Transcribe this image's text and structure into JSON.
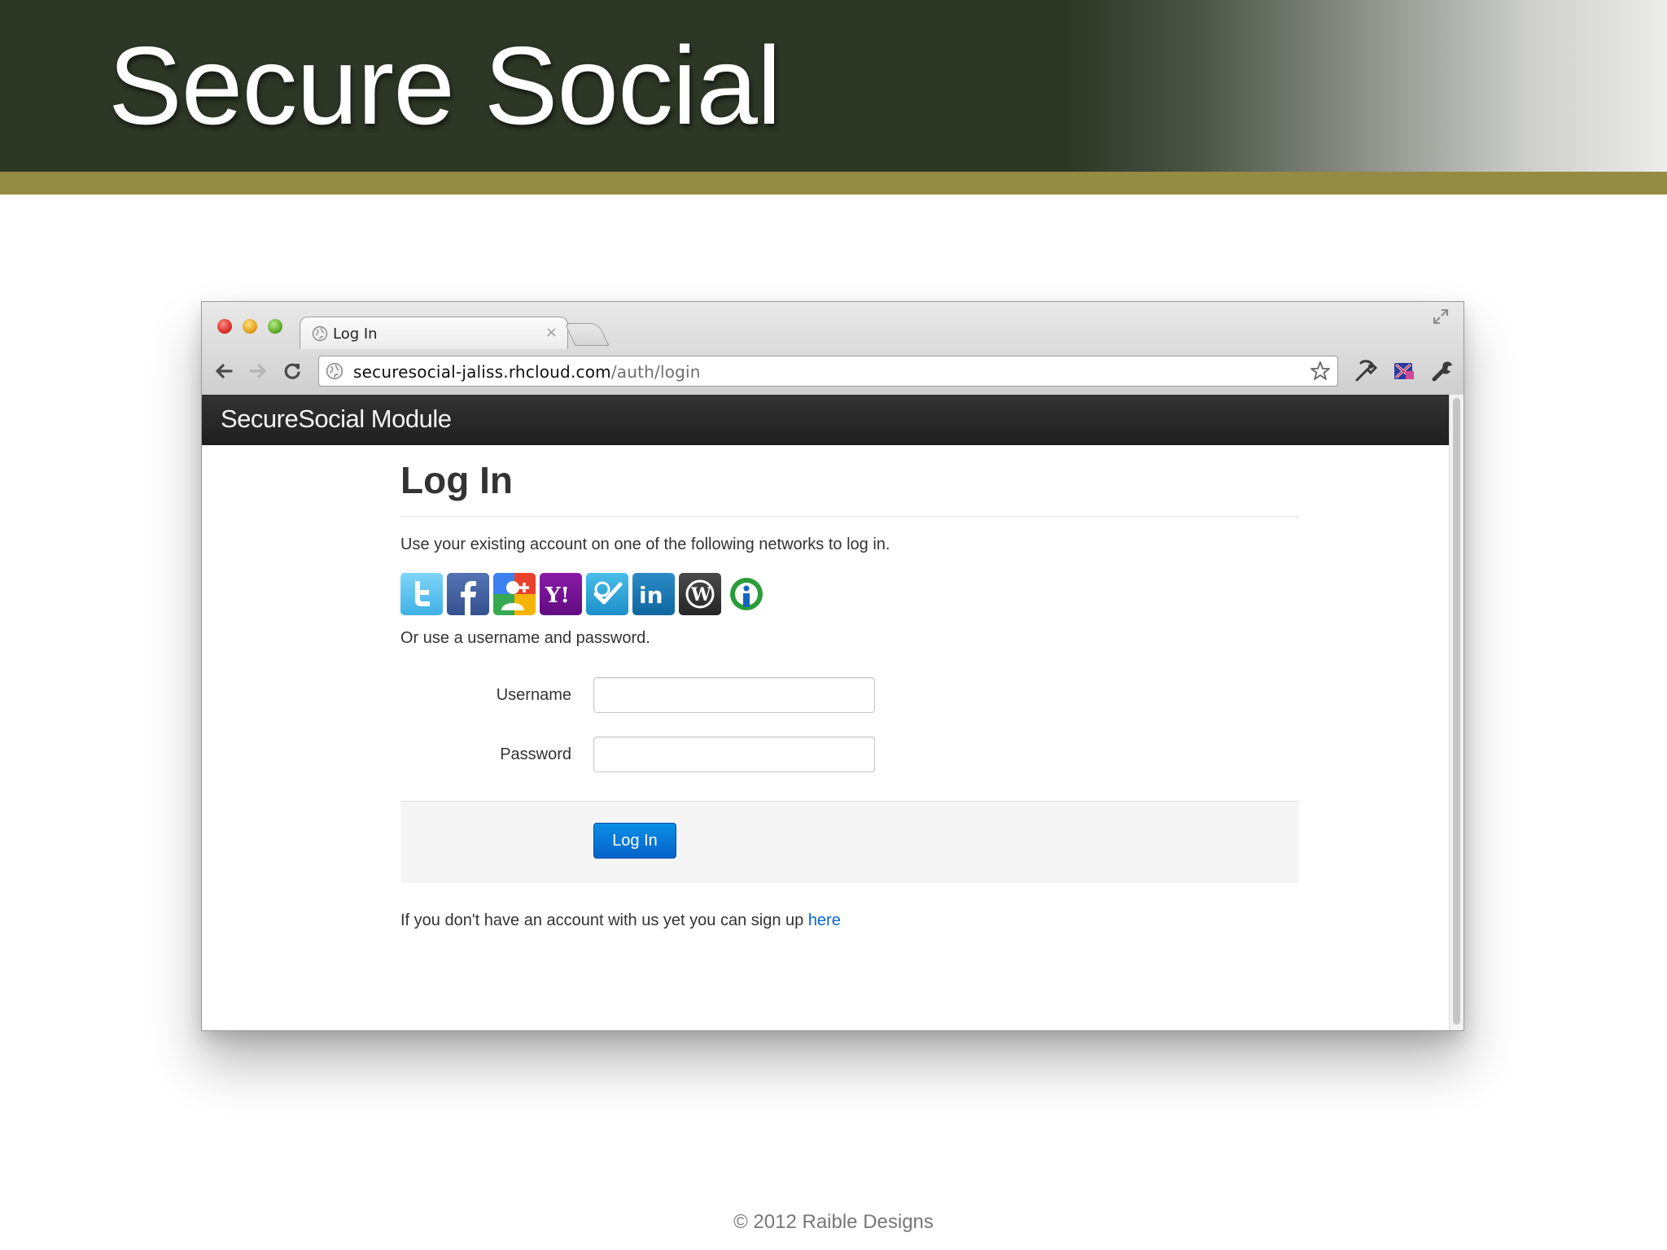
{
  "slide": {
    "title": "Secure Social",
    "footer": "© 2012 Raible Designs",
    "colors": {
      "header_bg": "#2d3726",
      "stripe": "#948b44"
    }
  },
  "browser": {
    "tab_title": "Log In",
    "tab_close": "×",
    "url_host": "securesocial-jaliss.rhcloud.com",
    "url_path": "/auth/login"
  },
  "page": {
    "brand": "SecureSocial Module",
    "heading": "Log In",
    "intro": "Use your existing account on one of the following networks to log in.",
    "providers": [
      {
        "name": "twitter",
        "icon": "twitter-icon",
        "color": "#5ec3f0"
      },
      {
        "name": "facebook",
        "icon": "facebook-icon",
        "color": "#3b5998"
      },
      {
        "name": "google",
        "icon": "google-icon",
        "color": "#4c8cf5"
      },
      {
        "name": "yahoo",
        "icon": "yahoo-icon",
        "color": "#7b0099"
      },
      {
        "name": "foursquare",
        "icon": "foursquare-icon",
        "color": "#2ea9df"
      },
      {
        "name": "linkedin",
        "icon": "linkedin-icon",
        "color": "#1a79b3"
      },
      {
        "name": "wordpress",
        "icon": "wordpress-icon",
        "color": "#3a3a3a"
      },
      {
        "name": "openid",
        "icon": "openid-icon",
        "color": "#2b9c3a"
      }
    ],
    "or_text": "Or use a username and password.",
    "username_label": "Username",
    "username_value": "",
    "password_label": "Password",
    "password_value": "",
    "login_button": "Log In",
    "signup_text": "If you don't have an account with us yet you can sign up ",
    "signup_link": "here",
    "link_color": "#0a66cc",
    "button_color": "#0562c9"
  }
}
